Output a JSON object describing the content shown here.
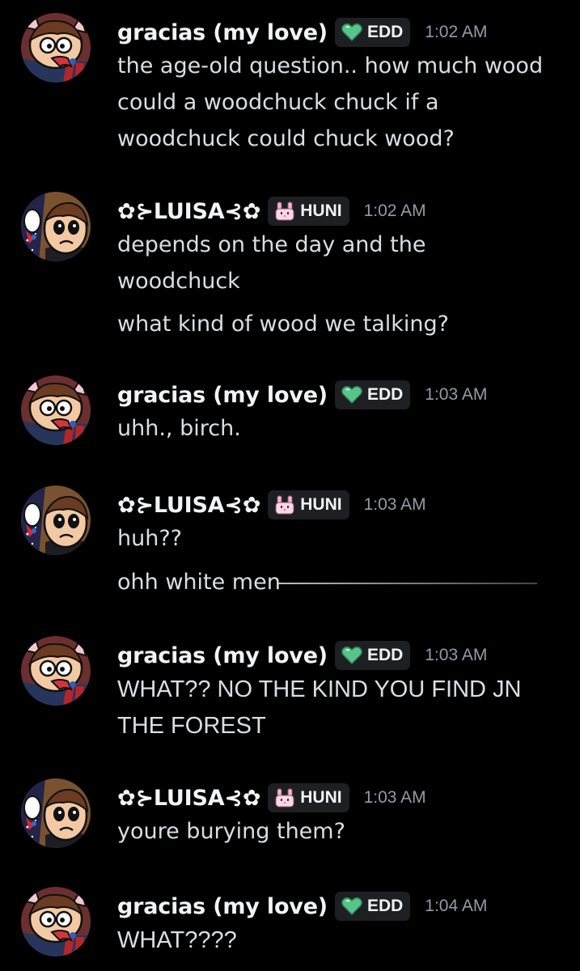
{
  "users": {
    "gracias": {
      "name": "gracias (my love)",
      "tag": "EDD",
      "tag_icon": "green-heart-icon",
      "tag_color": "#3ba55d"
    },
    "luisa": {
      "name": "✿⊱LUISA⊰✿",
      "tag": "HUNI",
      "tag_icon": "pink-bunny-icon",
      "tag_color": "#f4a7c8"
    }
  },
  "messages": [
    {
      "author": "gracias (my love)",
      "tag": "EDD",
      "time": "1:02 AM",
      "lines": [
        "the age-old question.. how much wood",
        "could a woodchuck chuck if a",
        "woodchuck could chuck wood?"
      ]
    },
    {
      "author": "✿⊱LUISA⊰✿",
      "tag": "HUNI",
      "time": "1:02 AM",
      "lines": [
        "depends on the day and the",
        "woodchuck",
        "what kind of wood we talking?"
      ]
    },
    {
      "author": "gracias (my love)",
      "tag": "EDD",
      "time": "1:03 AM",
      "lines": [
        "uhh., birch."
      ]
    },
    {
      "author": "✿⊱LUISA⊰✿",
      "tag": "HUNI",
      "time": "1:03 AM",
      "lines": [
        "huh??",
        "ohh white men"
      ]
    },
    {
      "author": "gracias (my love)",
      "tag": "EDD",
      "time": "1:03 AM",
      "lines": [
        "WHAT?? NO THE KIND YOU FIND JN",
        "THE FOREST"
      ]
    },
    {
      "author": "✿⊱LUISA⊰✿",
      "tag": "HUNI",
      "time": "1:03 AM",
      "lines": [
        "youre burying them?"
      ]
    },
    {
      "author": "gracias (my love)",
      "tag": "EDD",
      "time": "1:04 AM",
      "lines": [
        "WHAT????"
      ]
    }
  ],
  "colors": {
    "background": "#000000",
    "username": "#f2f3f5",
    "message_text": "#dbdee1",
    "timestamp": "#949ba4",
    "tag_bg": "#1e1f22"
  }
}
